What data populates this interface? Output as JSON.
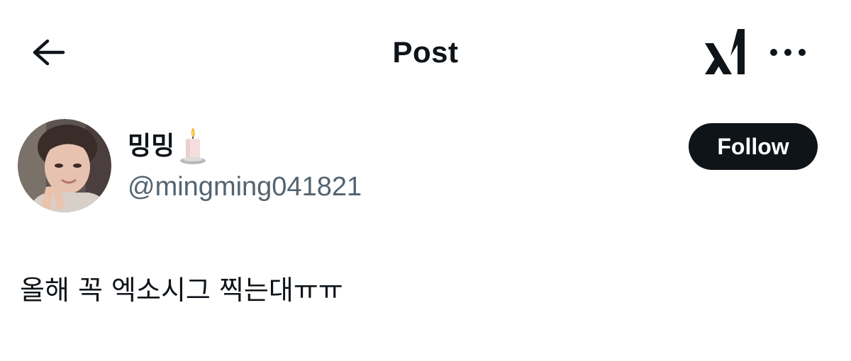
{
  "header": {
    "back_icon": "arrow-left-icon",
    "title": "Post",
    "grok_icon": "grok-icon",
    "more_icon": "ellipsis-icon"
  },
  "post": {
    "author": {
      "display_name": "밍밍",
      "name_emoji": "candle-emoji",
      "handle": "@mingming041821",
      "avatar": "user-avatar"
    },
    "follow_label": "Follow",
    "text": "올해 꼭 엑소시그 찍는대ㅠㅠ"
  },
  "colors": {
    "text_primary": "#0f1419",
    "text_secondary": "#536471",
    "button_bg": "#0f1419",
    "button_text": "#ffffff",
    "background": "#ffffff"
  }
}
